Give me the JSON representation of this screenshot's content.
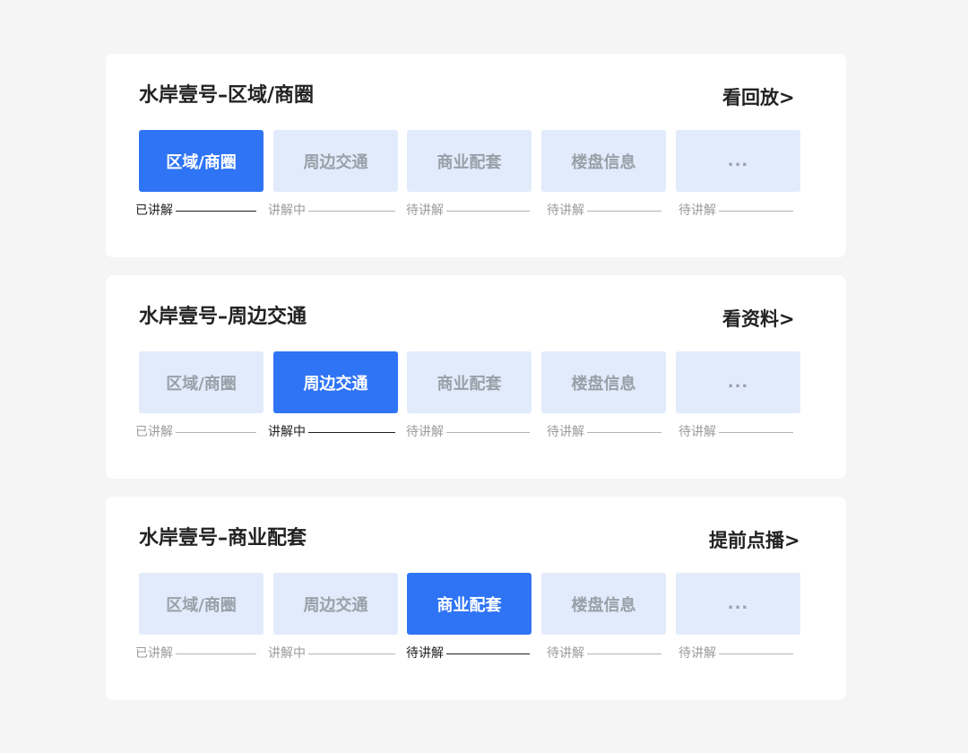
{
  "sections": [
    {
      "title": "水岸壹号–区域/商圈",
      "action": "看回放>",
      "tabs": [
        {
          "label": "区域/商圈",
          "active": true
        },
        {
          "label": "周边交通",
          "active": false
        },
        {
          "label": "商业配套",
          "active": false
        },
        {
          "label": "楼盘信息",
          "active": false
        },
        {
          "label": "...",
          "active": false
        }
      ],
      "statuses": [
        {
          "label": "已讲解",
          "current": true
        },
        {
          "label": "讲解中",
          "current": false
        },
        {
          "label": "待讲解",
          "current": false
        },
        {
          "label": "待讲解",
          "current": false
        },
        {
          "label": "待讲解",
          "current": false
        }
      ]
    },
    {
      "title": "水岸壹号–周边交通",
      "action": "看资料>",
      "tabs": [
        {
          "label": "区域/商圈",
          "active": false
        },
        {
          "label": "周边交通",
          "active": true
        },
        {
          "label": "商业配套",
          "active": false
        },
        {
          "label": "楼盘信息",
          "active": false
        },
        {
          "label": "...",
          "active": false
        }
      ],
      "statuses": [
        {
          "label": "已讲解",
          "current": false
        },
        {
          "label": "讲解中",
          "current": true
        },
        {
          "label": "待讲解",
          "current": false
        },
        {
          "label": "待讲解",
          "current": false
        },
        {
          "label": "待讲解",
          "current": false
        }
      ]
    },
    {
      "title": "水岸壹号–商业配套",
      "action": "提前点播>",
      "tabs": [
        {
          "label": "区域/商圈",
          "active": false
        },
        {
          "label": "周边交通",
          "active": false
        },
        {
          "label": "商业配套",
          "active": true
        },
        {
          "label": "楼盘信息",
          "active": false
        },
        {
          "label": "...",
          "active": false
        }
      ],
      "statuses": [
        {
          "label": "已讲解",
          "current": false
        },
        {
          "label": "讲解中",
          "current": false
        },
        {
          "label": "待讲解",
          "current": true
        },
        {
          "label": "待讲解",
          "current": false
        },
        {
          "label": "待讲解",
          "current": false
        }
      ]
    }
  ],
  "colors": {
    "accent": "#2f74f5",
    "tab_inactive_bg": "#e1ebfb",
    "tab_inactive_text": "#9aa0a8",
    "page_bg": "#f5f5f5"
  }
}
